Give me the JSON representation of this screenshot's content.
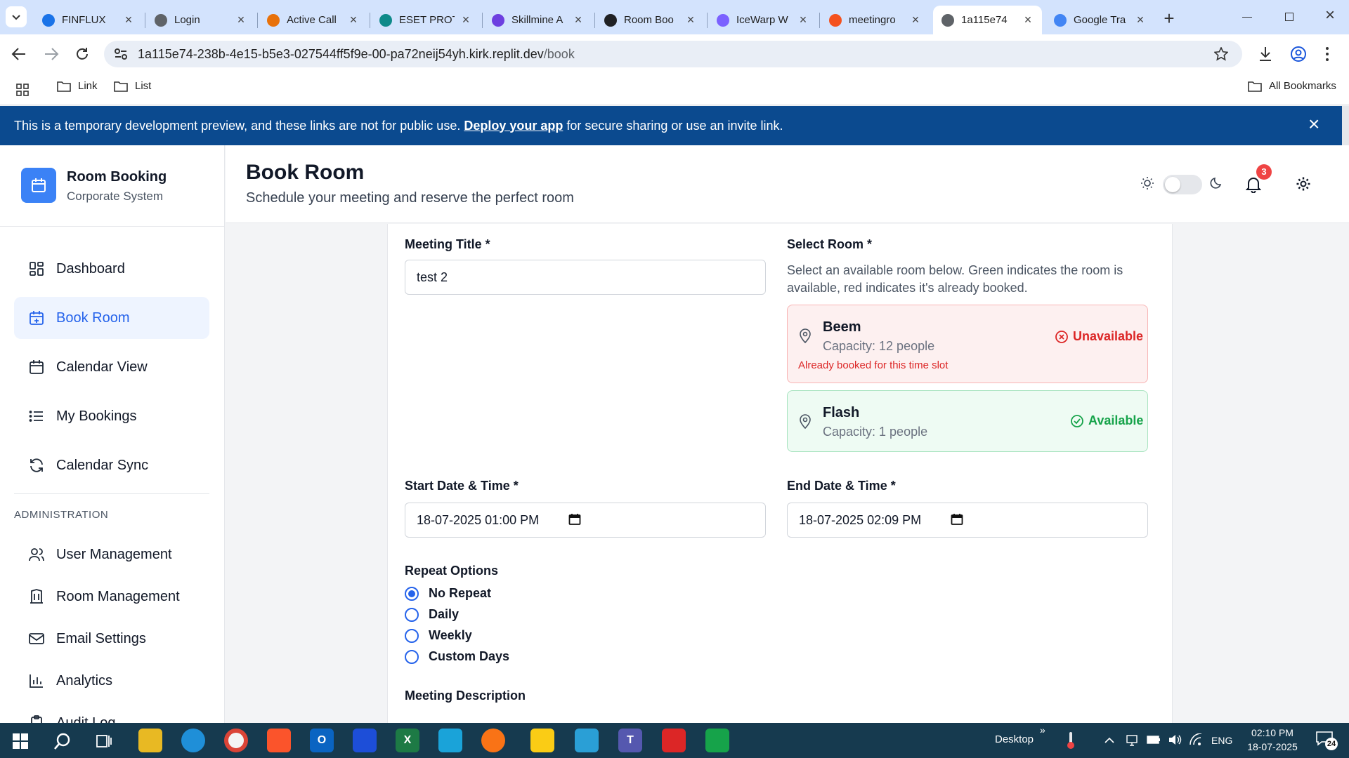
{
  "browser": {
    "tabs": [
      {
        "title": "FINFLUX",
        "color": "#1a73e8"
      },
      {
        "title": "Login",
        "color": "#5f6368"
      },
      {
        "title": "Active Call",
        "color": "#e8710a"
      },
      {
        "title": "ESET PROT",
        "color": "#0e8a8a"
      },
      {
        "title": "Skillmine A",
        "color": "#6d3fe0"
      },
      {
        "title": "Room Boo",
        "color": "#202124"
      },
      {
        "title": "IceWarp W",
        "color": "#7b61ff"
      },
      {
        "title": "meetingro",
        "color": "#f4511e"
      },
      {
        "title": "1a115e74",
        "color": "#5f6368"
      },
      {
        "title": "Google Tra",
        "color": "#4285f4"
      }
    ],
    "url_host": "1a115e74-238b-4e15-b5e3-027544ff5f9e-00-pa72neij54yh.kirk.replit.dev",
    "url_path": "/book",
    "bookmarks": [
      "Link",
      "List"
    ],
    "all_bookmarks": "All Bookmarks"
  },
  "banner": {
    "text_before": "This is a temporary development preview, and these links are not for public use.",
    "link": "Deploy your app",
    "text_after": "for secure sharing or use an invite link."
  },
  "app": {
    "name": "Room Booking",
    "subtitle": "Corporate System",
    "nav": [
      {
        "label": "Dashboard",
        "icon": "dashboard-icon"
      },
      {
        "label": "Book Room",
        "icon": "calendar-plus-icon",
        "active": true
      },
      {
        "label": "Calendar View",
        "icon": "calendar-icon"
      },
      {
        "label": "My Bookings",
        "icon": "list-icon"
      },
      {
        "label": "Calendar Sync",
        "icon": "sync-icon"
      }
    ],
    "admin_heading": "ADMINISTRATION",
    "admin_nav": [
      {
        "label": "User Management",
        "icon": "users-icon"
      },
      {
        "label": "Room Management",
        "icon": "building-icon"
      },
      {
        "label": "Email Settings",
        "icon": "mail-icon"
      },
      {
        "label": "Analytics",
        "icon": "bar-chart-icon"
      },
      {
        "label": "Audit Log",
        "icon": "clipboard-icon"
      }
    ]
  },
  "header": {
    "title": "Book Room",
    "subtitle": "Schedule your meeting and reserve the perfect room",
    "notification_count": "3"
  },
  "form": {
    "meeting_title_label": "Meeting Title *",
    "meeting_title_value": "test 2",
    "select_room_label": "Select Room *",
    "select_room_help": "Select an available room below. Green indicates the room is available, red indicates it's already booked.",
    "rooms": [
      {
        "name": "Beem",
        "capacity": "Capacity: 12 people",
        "status": "Unavailable",
        "note": "Already booked for this time slot"
      },
      {
        "name": "Flash",
        "capacity": "Capacity: 1 people",
        "status": "Available"
      }
    ],
    "start_label": "Start Date & Time *",
    "start_value": "18-07-2025 01:00 PM",
    "end_label": "End Date & Time *",
    "end_value": "18-07-2025 02:09 PM",
    "repeat_label": "Repeat Options",
    "repeat_options": [
      "No Repeat",
      "Daily",
      "Weekly",
      "Custom Days"
    ],
    "repeat_selected": "No Repeat",
    "description_label": "Meeting Description"
  },
  "taskbar": {
    "desktop_label": "Desktop",
    "language": "ENG",
    "time": "02:10 PM",
    "date": "18-07-2025",
    "notifications": "24"
  },
  "colors": {
    "accent": "#2563eb",
    "banner": "#0b4a8f",
    "unavailable": "#dc2626",
    "available": "#16a34a",
    "notification_badge": "#ef4444"
  }
}
